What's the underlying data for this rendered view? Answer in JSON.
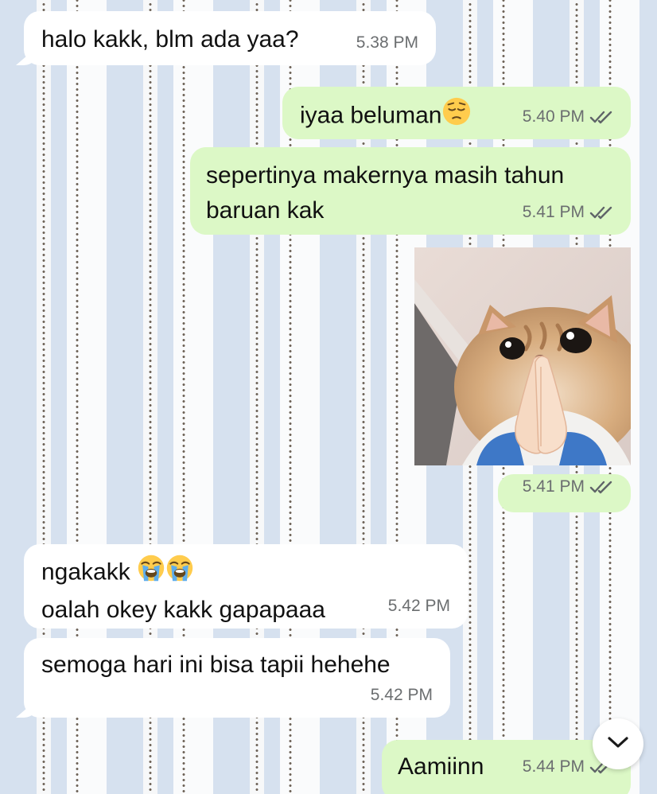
{
  "messages": [
    {
      "direction": "incoming",
      "lines": [
        "halo kakk, blm ada yaa?"
      ],
      "time": "5.38 PM"
    },
    {
      "direction": "outgoing",
      "lines": [
        "iyaa beluman"
      ],
      "emoji": "pensive-face",
      "time": "5.40 PM",
      "read": true
    },
    {
      "direction": "outgoing",
      "lines": [
        "sepertinya makernya masih tahun",
        "baruan kak"
      ],
      "time": "5.41 PM",
      "read": true
    },
    {
      "direction": "outgoing",
      "type": "sticker",
      "sticker": "cat-praying-hands",
      "time": "5.41 PM",
      "read": true
    },
    {
      "direction": "incoming",
      "lines": [
        "ngakakk",
        "oalah okey kakk gapapaaa"
      ],
      "emoji": "loudly-crying-face",
      "time": "5.42 PM"
    },
    {
      "direction": "incoming",
      "lines": [
        "semoga hari ini bisa tapii hehehe"
      ],
      "time": "5.42 PM"
    },
    {
      "direction": "outgoing",
      "lines": [
        "Aamiinn"
      ],
      "time": "5.44 PM",
      "read": true
    }
  ],
  "icons": {
    "read_receipt": "double-check-icon",
    "scroll_down": "chevron-down-icon"
  },
  "colors": {
    "incoming_bubble": "#ffffff",
    "outgoing_bubble": "#dcf8c6",
    "timestamp": "#6b6e70",
    "wallpaper_blue": "#d6e1ef"
  }
}
